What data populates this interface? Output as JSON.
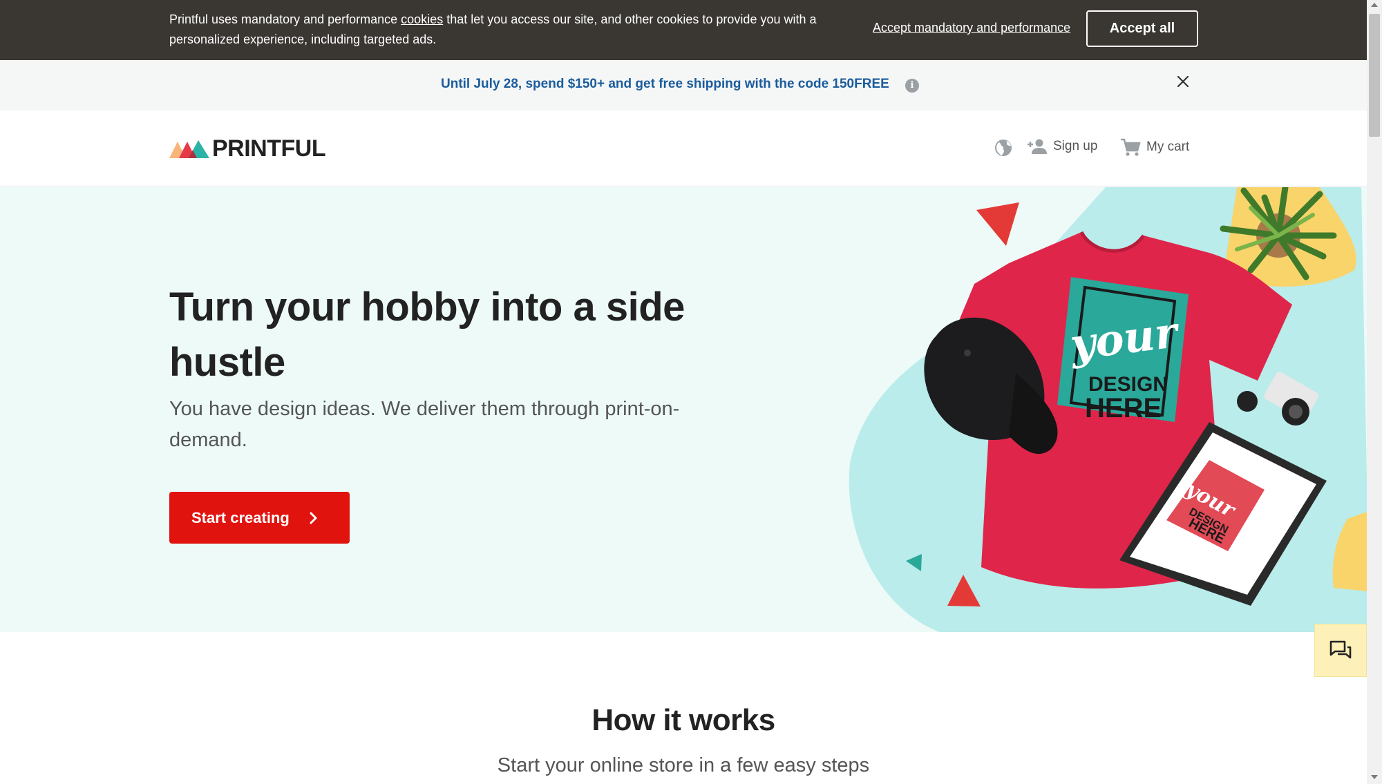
{
  "cookie_banner": {
    "text_before_link": "Printful uses mandatory and performance ",
    "link_text": "cookies",
    "text_after_link": " that let you access our site, and other cookies to provide you with a personalized experience, including targeted ads.",
    "accept_mandatory_label": "Accept mandatory and performance",
    "accept_all_label": "Accept all"
  },
  "promo": {
    "text": "Until July 28, spend $150+ and get free shipping with the code 150FREE",
    "info_icon": "i"
  },
  "header": {
    "logo_text": "PRINTFUL",
    "signup_label": "Sign up",
    "cart_label": "My cart",
    "icons": [
      "globe-icon",
      "add-person-icon",
      "cart-icon"
    ]
  },
  "hero": {
    "title": "Turn your hobby into a side hustle",
    "subtitle": "You have design ideas. We deliver them through print-on-demand.",
    "cta_label": "Start creating",
    "shirt_text_1": "your",
    "shirt_text_2": "DESIGN",
    "shirt_text_3": "HERE",
    "frame_text_1": "your",
    "frame_text_2": "DESIGN",
    "frame_text_3": "HERE"
  },
  "how_it_works": {
    "title": "How it works",
    "subtitle": "Start your online store in a few easy steps"
  },
  "colors": {
    "cookie_bg": "#3a3632",
    "promo_text": "#1a5c9c",
    "hero_bg": "#edfaf7",
    "cta": "#e1130f",
    "shirt": "#e0254a",
    "teal": "#2aa89a",
    "yellow": "#f9d46b",
    "chat_bg": "#fdf0b8"
  }
}
